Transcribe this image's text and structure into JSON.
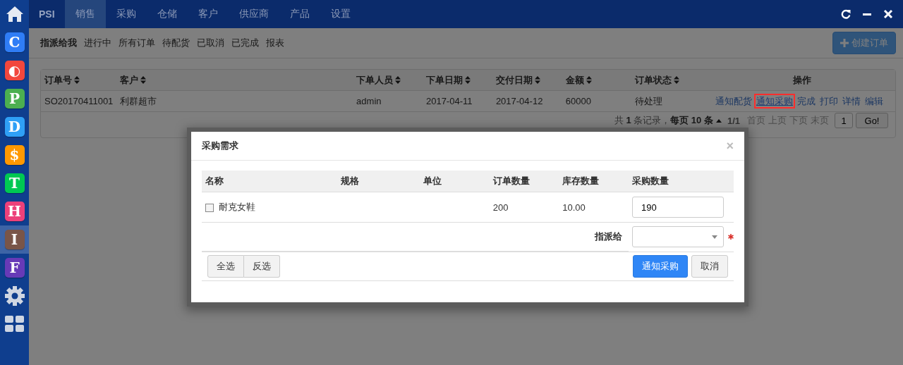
{
  "sidebar": {
    "items": [
      {
        "glyph": "C",
        "color": "#2f7df6",
        "selected": false
      },
      {
        "glyph": "◐",
        "color": "#f2473d",
        "selected": false
      },
      {
        "glyph": "P",
        "color": "#4caf50",
        "selected": false
      },
      {
        "glyph": "D",
        "color": "#2fa0f6",
        "selected": false
      },
      {
        "glyph": "$",
        "color": "#ff9800",
        "selected": false
      },
      {
        "glyph": "T",
        "color": "#00c853",
        "selected": false
      },
      {
        "glyph": "H",
        "color": "#ec407a",
        "selected": false
      },
      {
        "glyph": "I",
        "color": "#795548",
        "selected": true
      },
      {
        "glyph": "F",
        "color": "#673ab7",
        "selected": false
      }
    ]
  },
  "top_nav": {
    "brand": "PSI",
    "tabs": [
      {
        "label": "销售",
        "selected": true
      },
      {
        "label": "采购",
        "selected": false
      },
      {
        "label": "仓储",
        "selected": false
      },
      {
        "label": "客户",
        "selected": false
      },
      {
        "label": "供应商",
        "selected": false
      },
      {
        "label": "产品",
        "selected": false
      },
      {
        "label": "设置",
        "selected": false
      }
    ]
  },
  "sub_nav": {
    "tabs": [
      {
        "label": "指派给我",
        "selected": true
      },
      {
        "label": "进行中",
        "selected": false
      },
      {
        "label": "所有订单",
        "selected": false
      },
      {
        "label": "待配货",
        "selected": false
      },
      {
        "label": "已取消",
        "selected": false
      },
      {
        "label": "已完成",
        "selected": false
      },
      {
        "label": "报表",
        "selected": false
      }
    ],
    "create_button": "创建订单"
  },
  "orders_table": {
    "columns": [
      {
        "label": "订单号",
        "sortable": true
      },
      {
        "label": "客户",
        "sortable": true
      },
      {
        "label": "下单人员",
        "sortable": true
      },
      {
        "label": "下单日期",
        "sortable": true
      },
      {
        "label": "交付日期",
        "sortable": true
      },
      {
        "label": "金额",
        "sortable": true
      },
      {
        "label": "订单状态",
        "sortable": true
      },
      {
        "label": "操作",
        "sortable": false
      }
    ],
    "rows": [
      {
        "cells": [
          "SO20170411001",
          "利群超市",
          "admin",
          "2017-04-11",
          "2017-04-12",
          "60000",
          "待处理"
        ],
        "actions": [
          {
            "label": "通知配货",
            "highlighted": false
          },
          {
            "label": "通知采购",
            "highlighted": true
          },
          {
            "label": "完成",
            "highlighted": false
          },
          {
            "label": "打印",
            "highlighted": false
          },
          {
            "label": "详情",
            "highlighted": false
          },
          {
            "label": "编辑",
            "highlighted": false
          }
        ]
      }
    ],
    "pagination": {
      "summary": "共 **1** 条记录，**每页 10 条**",
      "page": "1/1",
      "links": [
        {
          "label": "首页",
          "disabled": true
        },
        {
          "label": "上页",
          "disabled": true
        },
        {
          "label": "下页",
          "disabled": true
        },
        {
          "label": "末页",
          "disabled": true
        }
      ],
      "page_input": "1",
      "go_button": "Go!"
    }
  },
  "modal": {
    "title": "采购需求",
    "close": "×",
    "columns": [
      "名称",
      "规格",
      "单位",
      "订单数量",
      "库存数量",
      "采购数量"
    ],
    "items": [
      {
        "name": "耐克女鞋",
        "checked": false,
        "order_qty": "200",
        "stock_qty": "10.00",
        "purchase_qty": "190"
      }
    ],
    "assign": {
      "label": "指派给",
      "required": true
    },
    "select_all": "全选",
    "invert": "反选",
    "submit": "通知采购",
    "cancel": "取消"
  }
}
